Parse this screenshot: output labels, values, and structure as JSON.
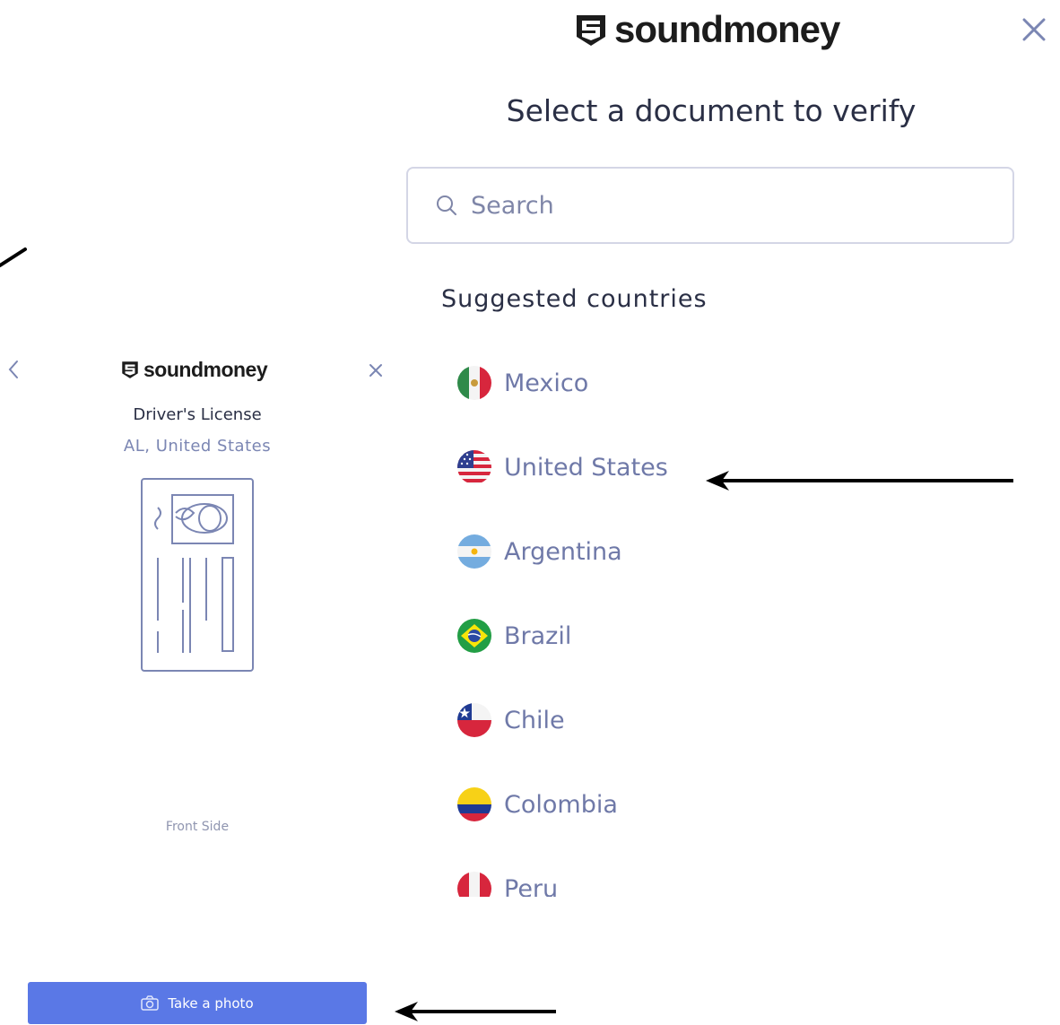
{
  "right_panel": {
    "logo_text": "soundmoney",
    "title": "Select a document to verify",
    "search": {
      "placeholder": "Search",
      "value": ""
    },
    "suggested_heading": "Suggested countries",
    "countries": [
      {
        "name": "Mexico",
        "flag": "mexico-flag-icon"
      },
      {
        "name": "United States",
        "flag": "us-flag-icon"
      },
      {
        "name": "Argentina",
        "flag": "argentina-flag-icon"
      },
      {
        "name": "Brazil",
        "flag": "brazil-flag-icon"
      },
      {
        "name": "Chile",
        "flag": "chile-flag-icon"
      },
      {
        "name": "Colombia",
        "flag": "colombia-flag-icon"
      },
      {
        "name": "Peru",
        "flag": "peru-flag-icon"
      }
    ]
  },
  "left_panel": {
    "logo_text": "soundmoney",
    "document_type": "Driver's License",
    "document_region": "AL, United States",
    "side_label": "Front Side",
    "take_photo_label": "Take a photo"
  },
  "colors": {
    "accent": "#5a78e6",
    "muted_text": "#6f79a8",
    "border": "#d4d6e6",
    "heading": "#2a2f45"
  }
}
